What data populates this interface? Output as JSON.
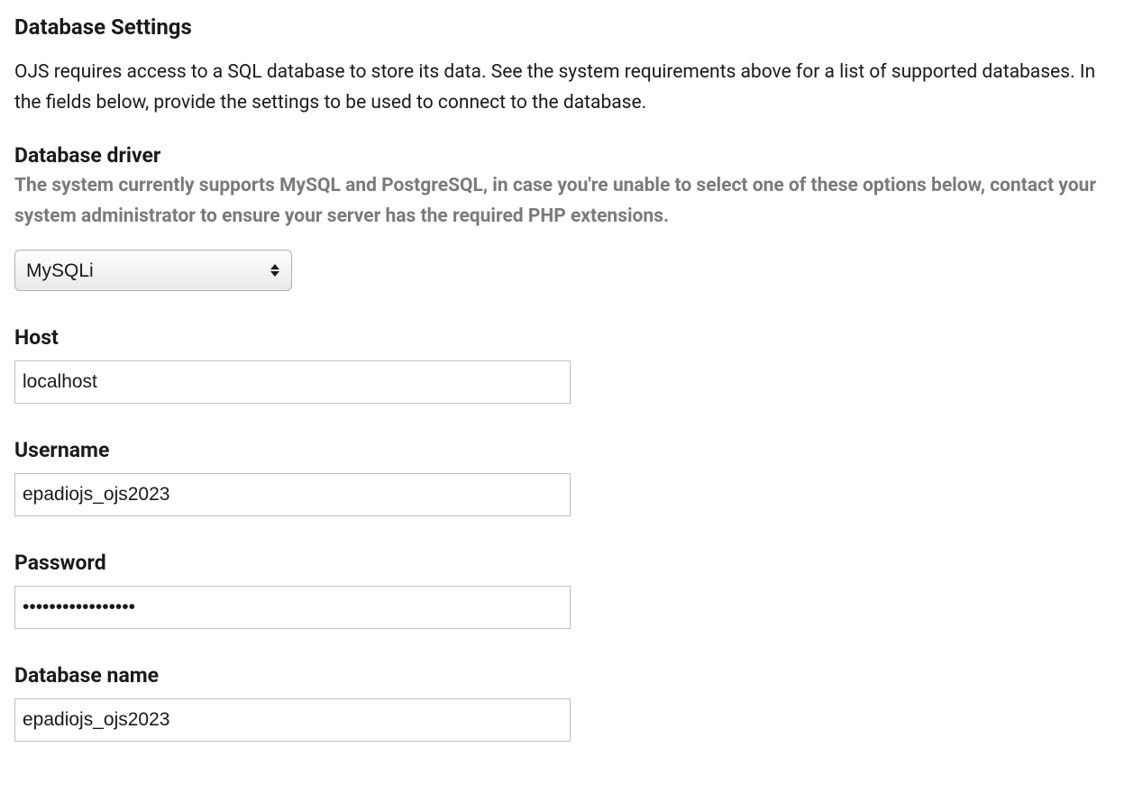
{
  "heading": "Database Settings",
  "description": "OJS requires access to a SQL database to store its data. See the system requirements above for a list of supported databases. In the fields below, provide the settings to be used to connect to the database.",
  "driver": {
    "label": "Database driver",
    "help": "The system currently supports MySQL and PostgreSQL, in case you're unable to select one of these options below, contact your system administrator to ensure your server has the required PHP extensions.",
    "value": "MySQLi"
  },
  "host": {
    "label": "Host",
    "value": "localhost"
  },
  "username": {
    "label": "Username",
    "value": "epadiojs_ojs2023"
  },
  "password": {
    "label": "Password",
    "value": "•••••••••••••••••"
  },
  "database_name": {
    "label": "Database name",
    "value": "epadiojs_ojs2023"
  }
}
